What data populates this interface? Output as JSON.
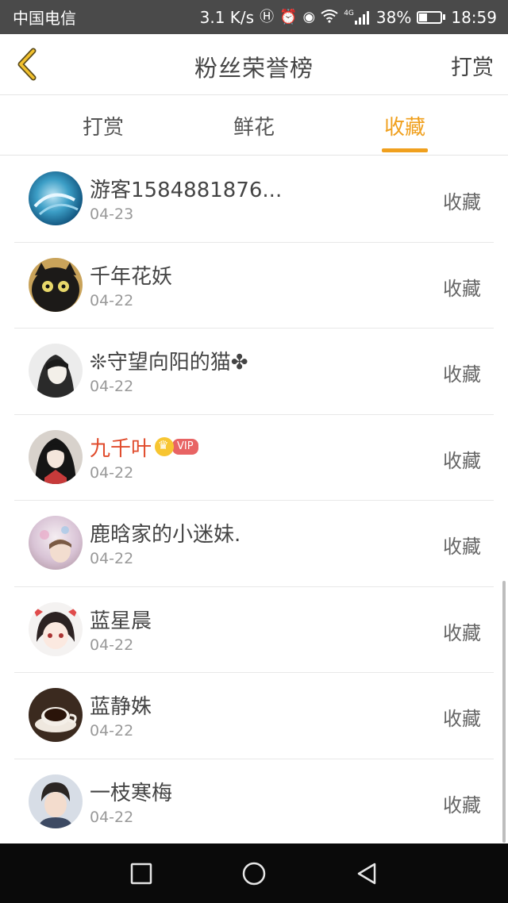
{
  "status_bar": {
    "carrier": "中国电信",
    "speed": "3.1 K/s",
    "network": "4G",
    "battery": "38%",
    "battery_level": 0.38,
    "time": "18:59"
  },
  "header": {
    "title": "粉丝荣誉榜",
    "action": "打赏"
  },
  "tabs": [
    {
      "label": "打赏",
      "active": false
    },
    {
      "label": "鲜花",
      "active": false
    },
    {
      "label": "收藏",
      "active": true
    }
  ],
  "accent_color": "#f0a01e",
  "fans": [
    {
      "name": "游客1584881876...",
      "date": "04-23",
      "action": "收藏",
      "vip": false
    },
    {
      "name": "千年花妖",
      "date": "04-22",
      "action": "收藏",
      "vip": false
    },
    {
      "name": "❊守望向阳的猫✤",
      "date": "04-22",
      "action": "收藏",
      "vip": false
    },
    {
      "name": "九千叶",
      "date": "04-22",
      "action": "收藏",
      "vip": true,
      "vip_label": "VIP"
    },
    {
      "name": "鹿晗家的小迷妹.",
      "date": "04-22",
      "action": "收藏",
      "vip": false
    },
    {
      "name": "蓝星晨",
      "date": "04-22",
      "action": "收藏",
      "vip": false
    },
    {
      "name": "蓝静姝",
      "date": "04-22",
      "action": "收藏",
      "vip": false
    },
    {
      "name": "一枝寒梅",
      "date": "04-22",
      "action": "收藏",
      "vip": false
    }
  ]
}
